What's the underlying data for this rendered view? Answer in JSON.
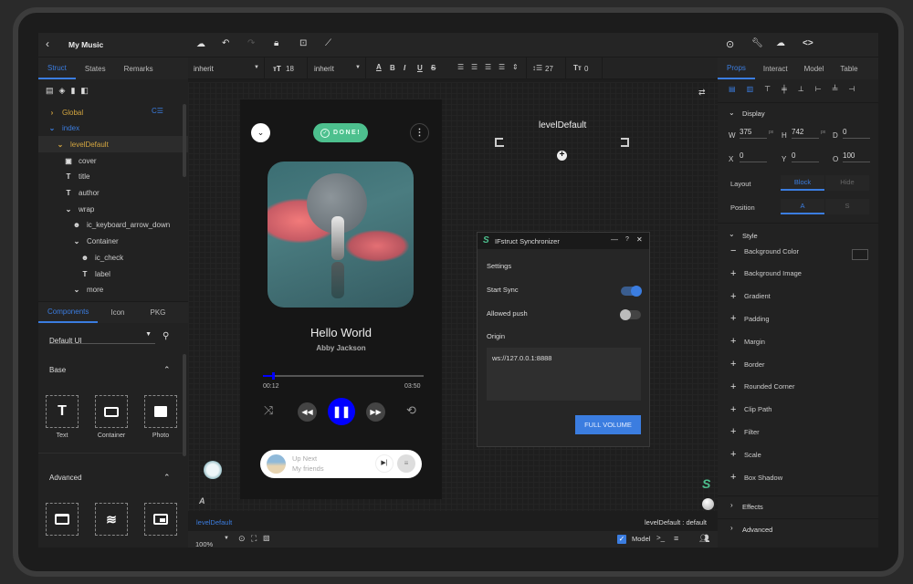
{
  "app": {
    "title": "My Music",
    "back_icon": "chevron-left-icon"
  },
  "left_panel": {
    "tabs": [
      {
        "label": "Struct",
        "active": true
      },
      {
        "label": "States",
        "active": false
      },
      {
        "label": "Remarks",
        "active": false
      }
    ],
    "tree_actions": [
      "new-page-icon",
      "layers-icon",
      "trash-icon",
      "copy-icon"
    ],
    "tree": [
      {
        "label": "Global",
        "depth": 0,
        "expanded": false,
        "icon": "chevron-right",
        "color": "#d4a640"
      },
      {
        "label": "index",
        "depth": 0,
        "expanded": true,
        "icon": "chevron-down",
        "color": "#3b7de0"
      },
      {
        "label": "levelDefault",
        "depth": 1,
        "expanded": true,
        "icon": "chevron-down",
        "color": "#d4a640",
        "selected": true
      },
      {
        "label": "cover",
        "depth": 2,
        "icon": "image"
      },
      {
        "label": "title",
        "depth": 2,
        "icon": "text"
      },
      {
        "label": "author",
        "depth": 2,
        "icon": "text"
      },
      {
        "label": "wrap",
        "depth": 2,
        "icon": "chevron-down"
      },
      {
        "label": "ic_keyboard_arrow_down",
        "depth": 3,
        "icon": "icon"
      },
      {
        "label": "Container",
        "depth": 3,
        "icon": "chevron-down"
      },
      {
        "label": "ic_check",
        "depth": 4,
        "icon": "icon"
      },
      {
        "label": "label",
        "depth": 4,
        "icon": "text"
      },
      {
        "label": "more",
        "depth": 3,
        "icon": "chevron-down"
      }
    ],
    "bottom_tabs": [
      {
        "label": "Components",
        "active": true
      },
      {
        "label": "Icon",
        "active": false
      },
      {
        "label": "PKG",
        "active": false
      }
    ],
    "library_select": "Default UI",
    "sections": [
      {
        "title": "Base",
        "items": [
          {
            "label": "Text",
            "icon": "text-icon"
          },
          {
            "label": "Container",
            "icon": "container-icon"
          },
          {
            "label": "Photo",
            "icon": "photo-icon"
          }
        ]
      },
      {
        "title": "Advanced",
        "items": [
          {
            "label": "",
            "icon": "window-icon"
          },
          {
            "label": "",
            "icon": "waves-icon"
          },
          {
            "label": "",
            "icon": "picture-in-picture-icon"
          }
        ]
      }
    ]
  },
  "toolbar": {
    "font_family": "inherit",
    "font_size": "18",
    "font_weight": "inherit",
    "line_height": "27",
    "letter_spacing": "0"
  },
  "canvas": {
    "level_label": "levelDefault",
    "breadcrumb": "levelDefault",
    "state_label": "levelDefault : default",
    "zoom": "100%",
    "model_checked": true,
    "model_label": "Model"
  },
  "phone": {
    "done_label": "DONE!",
    "song_title": "Hello World",
    "artist": "Abby Jackson",
    "elapsed": "00:12",
    "duration": "03:50",
    "progress": 0.06,
    "up_next_label": "Up Next",
    "up_next_song": "My friends",
    "accent": "#0000ff",
    "done_color": "#4dc08e"
  },
  "dialog": {
    "title": "IFstruct Synchronizer",
    "settings_label": "Settings",
    "start_sync_label": "Start Sync",
    "start_sync_on": true,
    "allowed_push_label": "Allowed push",
    "allowed_push_on": false,
    "origin_label": "Origin",
    "origin_value": "ws://127.0.0.1:8888",
    "action_label": "FULL VOLUME",
    "minimize": "—",
    "help": "?",
    "close": "✕"
  },
  "right_panel": {
    "tabs": [
      {
        "label": "Props",
        "active": true
      },
      {
        "label": "Interact",
        "active": false
      },
      {
        "label": "Model",
        "active": false
      },
      {
        "label": "Table",
        "active": false
      }
    ],
    "display_label": "Display",
    "w": "375",
    "h": "742",
    "d": "0",
    "x": "0",
    "y": "0",
    "o": "100",
    "unit": "px",
    "layout_label": "Layout",
    "layout_options": [
      "Block",
      "Hide"
    ],
    "position_label": "Position",
    "position_options": [
      "A",
      "S"
    ],
    "style_label": "Style",
    "style_items": [
      {
        "label": "Background Color",
        "sign": "−"
      },
      {
        "label": "Background Image",
        "sign": "+"
      },
      {
        "label": "Gradient",
        "sign": "+"
      },
      {
        "label": "Padding",
        "sign": "+"
      },
      {
        "label": "Margin",
        "sign": "+"
      },
      {
        "label": "Border",
        "sign": "+"
      },
      {
        "label": "Rounded Corner",
        "sign": "+"
      },
      {
        "label": "Clip Path",
        "sign": "+"
      },
      {
        "label": "Filter",
        "sign": "+"
      },
      {
        "label": "Scale",
        "sign": "+"
      },
      {
        "label": "Box Shadow",
        "sign": "+"
      }
    ],
    "effects_label": "Effects",
    "advanced_label": "Advanced"
  }
}
